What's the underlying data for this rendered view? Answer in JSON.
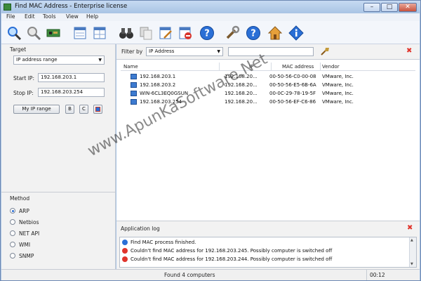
{
  "window": {
    "title": "Find MAC Address - Enterprise license",
    "controls": {
      "minimize": "–",
      "maximize": "□",
      "close": "✕"
    }
  },
  "menu": [
    "File",
    "Edit",
    "Tools",
    "View",
    "Help"
  ],
  "toolbar": {
    "buttons": [
      "find-mac-icon",
      "find-icon",
      "network-card-icon",
      "export-icon",
      "export-table-icon",
      "binoculars-icon",
      "copy-icon",
      "edit-icon",
      "delete-icon",
      "help-icon",
      "wrench-icon",
      "help-icon",
      "home-icon",
      "info-icon"
    ]
  },
  "target": {
    "heading": "Target",
    "mode": "IP address range",
    "start_label": "Start IP:",
    "start_value": "192.168.203.1",
    "stop_label": "Stop IP:",
    "stop_value": "192.168.203.254",
    "my_ip_range_btn": "My IP range",
    "b_btn": "B",
    "c_btn": "C"
  },
  "method": {
    "heading": "Method",
    "options": [
      "ARP",
      "Netbios",
      "NET API",
      "WMI",
      "SNMP"
    ],
    "selected": "ARP"
  },
  "filter": {
    "label": "Filter by",
    "value": "IP Address",
    "text": ""
  },
  "results": {
    "columns": [
      "Name",
      "IP",
      "MAC address",
      "Vendor"
    ],
    "rows": [
      {
        "name": "192.168.203.1",
        "ip": "192.168.20...",
        "mac": "00-50-56-C0-00-08",
        "vendor": "VMware, Inc."
      },
      {
        "name": "192.168.203.2",
        "ip": "192.168.20...",
        "mac": "00-50-56-E5-6B-6A",
        "vendor": "VMware, Inc."
      },
      {
        "name": "WIN-6CL3EQ0GSUN",
        "ip": "192.168.20...",
        "mac": "00-0C-29-78-19-5F",
        "vendor": "VMware, Inc."
      },
      {
        "name": "192.168.203.254",
        "ip": "192.168.20...",
        "mac": "00-50-56-EF-C6-86",
        "vendor": "VMware, Inc."
      }
    ]
  },
  "log": {
    "heading": "Application log",
    "entries": [
      {
        "type": "info",
        "text": "Find MAC process finished."
      },
      {
        "type": "error",
        "text": "Couldn't find MAC address for 192.168.203.245. Possibly computer is switched off"
      },
      {
        "type": "error",
        "text": "Couldn't find MAC address for 192.168.203.244. Possibly computer is switched off"
      }
    ]
  },
  "status": {
    "message": "Found 4 computers",
    "elapsed": "00:12"
  },
  "watermark": "www.ApunKaSoftware.Net",
  "colors": {
    "accent": "#2a6fd6",
    "error": "#e0342c",
    "info": "#2a6fd6"
  }
}
